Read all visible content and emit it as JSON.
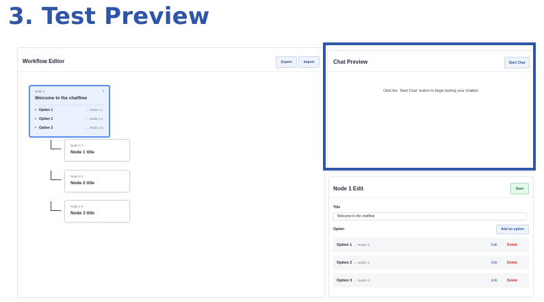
{
  "page_title": "3. Test Preview",
  "workflow_editor": {
    "title": "Workflow Editor",
    "export_label": "Export",
    "import_label": "Import",
    "root_node": {
      "label": "Node 1",
      "title": "Welcome to the chatflow",
      "add_icon": "plus-icon",
      "options": [
        {
          "bullet": "•",
          "name": "Option 1",
          "target": "→ Node 1-1"
        },
        {
          "bullet": "•",
          "name": "Option 2",
          "target": "→ Node 1-2"
        },
        {
          "bullet": "•",
          "name": "Option 3",
          "target": "→ Node 1-3"
        }
      ]
    },
    "child_nodes": [
      {
        "label": "Node 1-1",
        "title": "Node 1 title"
      },
      {
        "label": "Node 1-2",
        "title": "Node 2 title"
      },
      {
        "label": "Node 1-3",
        "title": "Node 3 title"
      }
    ]
  },
  "chat_preview": {
    "title": "Chat Preview",
    "start_label": "Start Chat",
    "message": "Click the `Start Chat` button to begin testing your chatbot.",
    "highlight_color": "#2f56a6"
  },
  "node_edit": {
    "title": "Node 1 Edit",
    "save_label": "Save",
    "title_field_label": "Title",
    "title_value": "Welcome to the chatflow",
    "option_label": "Option",
    "add_option_label": "Add an option",
    "options": [
      {
        "name": "Option 1",
        "target": "→ Node1-1",
        "edit": "Edit",
        "delete": "Delete"
      },
      {
        "name": "Option 2",
        "target": "→ Node1-2",
        "edit": "Edit",
        "delete": "Delete"
      },
      {
        "name": "Option 3",
        "target": "→ Node1-3",
        "edit": "Edit",
        "delete": "Delete"
      }
    ]
  }
}
